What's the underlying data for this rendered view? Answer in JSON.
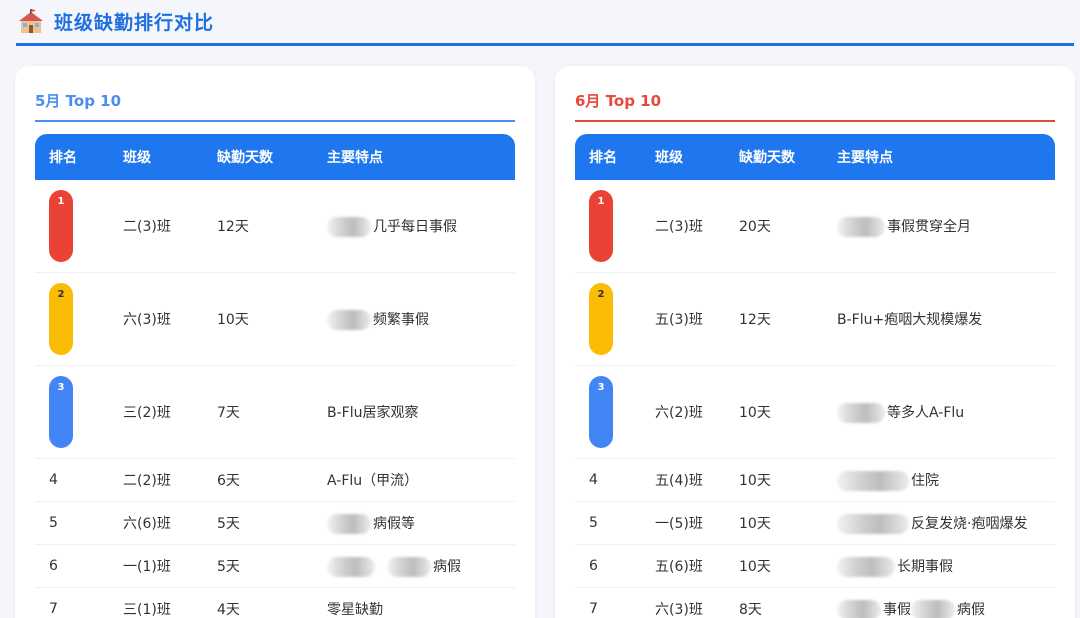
{
  "header": {
    "title": "班级缺勤排行对比",
    "icon": "school-icon"
  },
  "may": {
    "title": "5月 Top 10",
    "accent": "#4a8ef0",
    "columns": [
      "排名",
      "班级",
      "缺勤天数",
      "主要特点"
    ],
    "rows": [
      {
        "rank": "1",
        "class": "二(3)班",
        "days": "12天",
        "feature": "几乎每日事假"
      },
      {
        "rank": "2",
        "class": "六(3)班",
        "days": "10天",
        "feature": "频繁事假"
      },
      {
        "rank": "3",
        "class": "三(2)班",
        "days": "7天",
        "feature": "B-Flu居家观察"
      },
      {
        "rank": "4",
        "class": "二(2)班",
        "days": "6天",
        "feature": "A-Flu（甲流）"
      },
      {
        "rank": "5",
        "class": "六(6)班",
        "days": "5天",
        "feature": "病假等"
      },
      {
        "rank": "6",
        "class": "一(1)班",
        "days": "5天",
        "feature": "病假"
      },
      {
        "rank": "7",
        "class": "三(1)班",
        "days": "4天",
        "feature": "零星缺勤"
      }
    ]
  },
  "june": {
    "title": "6月 Top 10",
    "accent": "#e8473b",
    "columns": [
      "排名",
      "班级",
      "缺勤天数",
      "主要特点"
    ],
    "rows": [
      {
        "rank": "1",
        "class": "二(3)班",
        "days": "20天",
        "feature": "事假贯穿全月"
      },
      {
        "rank": "2",
        "class": "五(3)班",
        "days": "12天",
        "feature": "B-Flu+疱咽大规模爆发"
      },
      {
        "rank": "3",
        "class": "六(2)班",
        "days": "10天",
        "feature": "等多人A-Flu"
      },
      {
        "rank": "4",
        "class": "五(4)班",
        "days": "10天",
        "feature": "住院"
      },
      {
        "rank": "5",
        "class": "一(5)班",
        "days": "10天",
        "feature": "反复发烧·疱咽爆发"
      },
      {
        "rank": "6",
        "class": "五(6)班",
        "days": "10天",
        "feature": "长期事假"
      },
      {
        "rank": "7",
        "class": "六(3)班",
        "days": "8天",
        "feature": "事假",
        "feature2": "病假"
      }
    ]
  },
  "colors": {
    "primary": "#1e6fe0",
    "table_header": "#1e77ee",
    "rank1": "#ea4335",
    "rank2": "#fbbc05",
    "rank3": "#4285f4"
  }
}
